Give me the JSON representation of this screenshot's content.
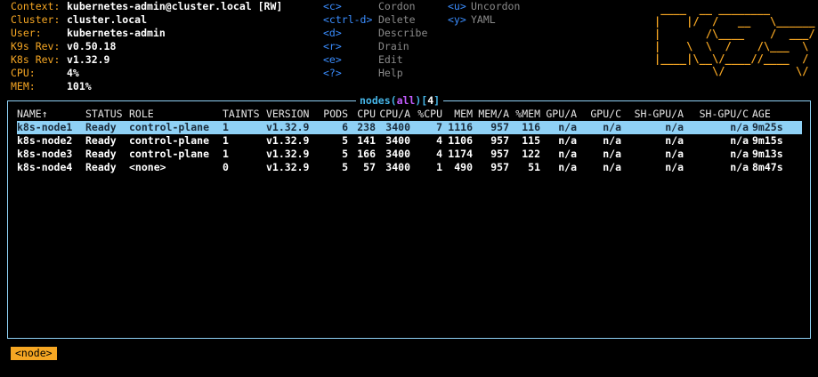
{
  "info": [
    {
      "label": "Context:",
      "value": "kubernetes-admin@cluster.local [RW]"
    },
    {
      "label": "Cluster:",
      "value": "cluster.local"
    },
    {
      "label": "User:",
      "value": "kubernetes-admin"
    },
    {
      "label": "K9s Rev:",
      "value": "v0.50.18"
    },
    {
      "label": "K8s Rev:",
      "value": "v1.32.9"
    },
    {
      "label": "CPU:",
      "value": "4%"
    },
    {
      "label": "MEM:",
      "value": "101%"
    }
  ],
  "shortcuts": [
    {
      "key": "<c>",
      "desc": "Cordon"
    },
    {
      "key": "<ctrl-d>",
      "desc": "Delete"
    },
    {
      "key": "<d>",
      "desc": "Describe"
    },
    {
      "key": "<r>",
      "desc": "Drain"
    },
    {
      "key": "<e>",
      "desc": "Edit"
    },
    {
      "key": "<?>",
      "desc": "Help"
    }
  ],
  "shortcuts2": [
    {
      "key": "<u>",
      "desc": "Uncordon"
    },
    {
      "key": "<y>",
      "desc": "YAML"
    }
  ],
  "logo_lines": [
    " ____  __ ________       ",
    "|    |/  /   __   \\______",
    "|       /\\____    /  ___/",
    "|    \\  \\  /    /\\___  \\ ",
    "|____|\\__\\/____//____  / ",
    "         \\/           \\/ "
  ],
  "frame": {
    "resource": "nodes",
    "namespace": "all",
    "count": "4"
  },
  "table": {
    "headers": [
      "NAME↑",
      "STATUS",
      "ROLE",
      "TAINTS",
      "VERSION",
      "PODS",
      "CPU",
      "CPU/A",
      "%CPU",
      "MEM",
      "MEM/A",
      "%MEM",
      "GPU/A",
      "GPU/C",
      "SH-GPU/A",
      "SH-GPU/C",
      "AGE"
    ],
    "rows": [
      [
        "k8s-node1",
        "Ready",
        "control-plane",
        "1",
        "v1.32.9",
        "6",
        "238",
        "3400",
        "7",
        "1116",
        "957",
        "116",
        "n/a",
        "n/a",
        "n/a",
        "n/a",
        "9m25s"
      ],
      [
        "k8s-node2",
        "Ready",
        "control-plane",
        "1",
        "v1.32.9",
        "5",
        "141",
        "3400",
        "4",
        "1106",
        "957",
        "115",
        "n/a",
        "n/a",
        "n/a",
        "n/a",
        "9m15s"
      ],
      [
        "k8s-node3",
        "Ready",
        "control-plane",
        "1",
        "v1.32.9",
        "5",
        "166",
        "3400",
        "4",
        "1174",
        "957",
        "122",
        "n/a",
        "n/a",
        "n/a",
        "n/a",
        "9m13s"
      ],
      [
        "k8s-node4",
        "Ready",
        "<none>",
        "0",
        "v1.32.9",
        "5",
        "57",
        "3400",
        "1",
        "490",
        "957",
        "51",
        "n/a",
        "n/a",
        "n/a",
        "n/a",
        "8m47s"
      ]
    ],
    "selected_row": 0
  },
  "breadcrumb": "<node>",
  "colors": {
    "accent": "#f5a623",
    "key": "#3a8dff",
    "frame": "#8fd1f5",
    "namespace": "#c35cff"
  }
}
